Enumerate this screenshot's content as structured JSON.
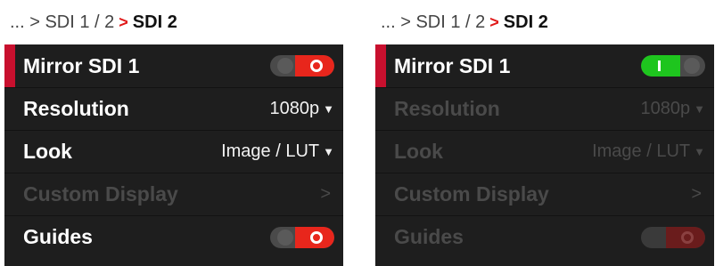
{
  "panels": [
    {
      "breadcrumb": {
        "prev": "... > SDI 1 / 2",
        "separator": ">",
        "current": "SDI 2"
      },
      "rows": [
        {
          "label": "Mirror SDI 1",
          "toggle_state": "off"
        },
        {
          "label": "Resolution",
          "value": "1080p"
        },
        {
          "label": "Look",
          "value": "Image / LUT"
        },
        {
          "label": "Custom Display",
          "chevron": ">"
        },
        {
          "label": "Guides",
          "toggle_state": "off"
        }
      ]
    },
    {
      "breadcrumb": {
        "prev": "... > SDI 1 / 2",
        "separator": ">",
        "current": "SDI 2"
      },
      "rows": [
        {
          "label": "Mirror SDI 1",
          "toggle_state": "on"
        },
        {
          "label": "Resolution",
          "value": "1080p"
        },
        {
          "label": "Look",
          "value": "Image / LUT"
        },
        {
          "label": "Custom Display",
          "chevron": ">"
        },
        {
          "label": "Guides",
          "toggle_state": "off"
        }
      ]
    }
  ],
  "icons": {
    "dropdown": "chevron-down-icon",
    "submenu": "chevron-right-icon",
    "switch": "toggle-switch"
  },
  "colors": {
    "accent_red": "#c8102e",
    "toggle_red": "#e8261c",
    "toggle_green": "#1ec51e",
    "menu_bg": "#1e1e1e"
  }
}
